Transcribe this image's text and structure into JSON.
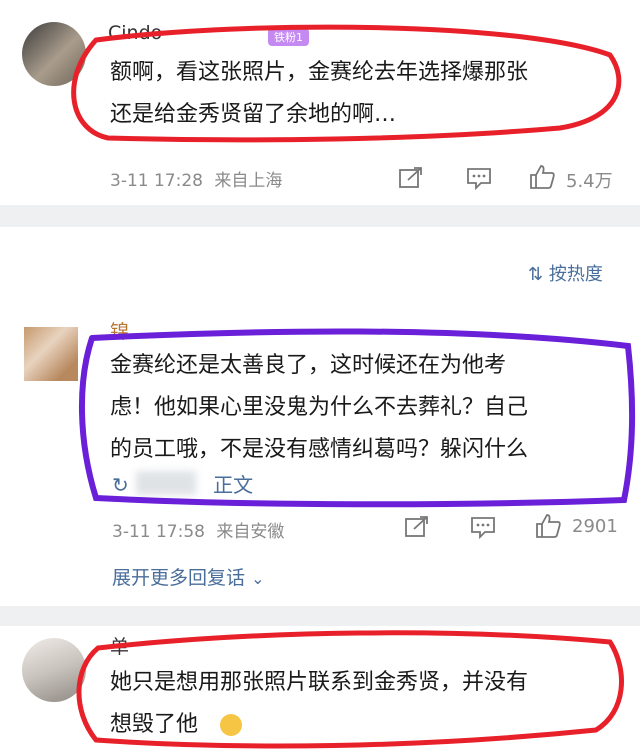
{
  "comment1": {
    "username": "Cindo",
    "badge": "铁粉1",
    "text": "额啊，看这张照片，金赛纶去年选择爆那张\n还是给金秀贤留了余地的啊…",
    "time": "3-11 17:28",
    "location": "来自上海",
    "likes": "5.4万"
  },
  "sort": {
    "label": "按热度"
  },
  "comment2": {
    "username": "锦",
    "text": "金赛纶还是太善良了，这时候还在为他考\n虑！他如果心里没鬼为什么不去葬礼？自己\n的员工哦，不是没有感情纠葛吗？躲闪什么",
    "link_suffix": "正文",
    "time": "3-11 17:58",
    "location": "来自安徽",
    "likes": "2901"
  },
  "expand": {
    "label": "展开更多回复话"
  },
  "comment3": {
    "username": "单",
    "text": "她只是想用那张照片联系到金秀贤，并没有\n想毁了他"
  },
  "colors": {
    "annotation_red": "#e8202a",
    "annotation_purple": "#6a1fd8",
    "link_blue": "#4a6e9c",
    "badge_purple": "#c58af2"
  }
}
